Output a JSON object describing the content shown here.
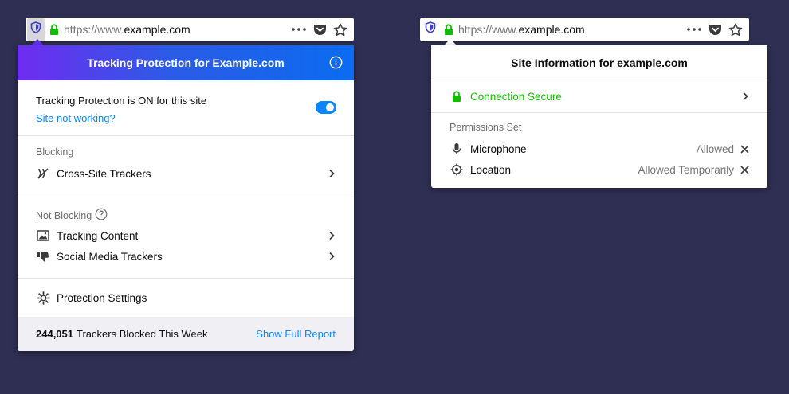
{
  "colors": {
    "background": "#2e2f52",
    "accent": "#0a84ff",
    "secure": "#12bc00"
  },
  "left_toolbar": {
    "url_prefix": "https://www.",
    "url_domain": "example.com"
  },
  "tracking_panel": {
    "title": "Tracking Protection for Example.com",
    "status_title": "Tracking Protection is ON for this site",
    "status_link": "Site not working?",
    "toggle_on": true,
    "blocking_label": "Blocking",
    "blocking_items": [
      {
        "label": "Cross-Site Trackers",
        "icon": "tracker-blocked-icon"
      }
    ],
    "not_blocking_label": "Not Blocking",
    "not_blocking_items": [
      {
        "label": "Tracking Content",
        "icon": "image-icon"
      },
      {
        "label": "Social Media Trackers",
        "icon": "thumbs-down-icon"
      }
    ],
    "settings_label": "Protection Settings",
    "footer_count": "244,051",
    "footer_text": "Trackers Blocked This Week",
    "footer_link": "Show Full Report"
  },
  "right_toolbar": {
    "url_prefix": "https://www.",
    "url_domain": "example.com"
  },
  "site_info_panel": {
    "title": "Site Information for example.com",
    "connection_label": "Connection Secure",
    "permissions_label": "Permissions Set",
    "permissions": [
      {
        "label": "Microphone",
        "state": "Allowed",
        "icon": "microphone-icon"
      },
      {
        "label": "Location",
        "state": "Allowed Temporarily",
        "icon": "location-icon"
      }
    ]
  }
}
